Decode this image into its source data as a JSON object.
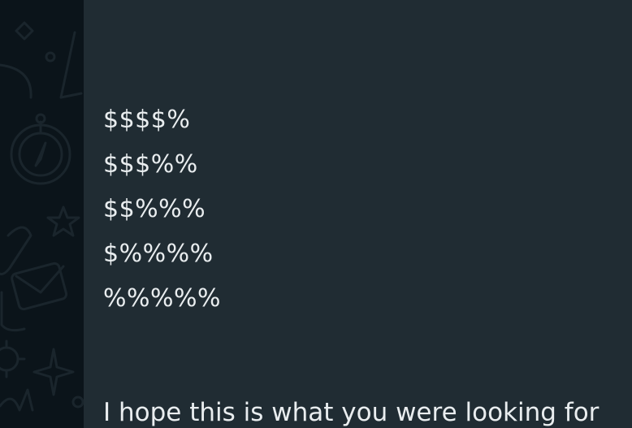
{
  "message": {
    "top_line": "",
    "pattern_lines": [
      "$$$$%",
      "$$$%%",
      "$$%%%",
      "$%%%%",
      "%%%%%"
    ],
    "closing": "I hope this is what you were looking for"
  },
  "colors": {
    "wallpaper": "#0b141a",
    "bubble": "#202c33",
    "text": "#e9edef",
    "doodle": "#1c262d"
  }
}
